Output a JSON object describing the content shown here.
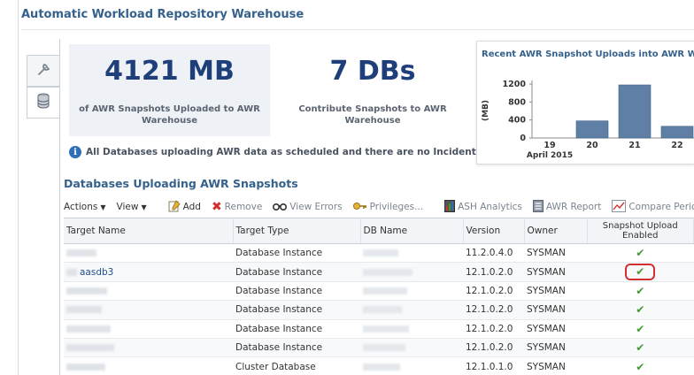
{
  "page": {
    "title": "Automatic Workload Repository Warehouse"
  },
  "side_tabs": [
    {
      "icon": "wrench-icon",
      "active": false
    },
    {
      "icon": "database-icon",
      "active": true
    }
  ],
  "summary": {
    "size_value": "4121 MB",
    "size_label": "of AWR Snapshots Uploaded to AWR Warehouse",
    "dbs_value": "7 DBs",
    "dbs_label": "Contribute Snapshots to AWR Warehouse"
  },
  "info": {
    "icon": "info-icon",
    "text": "All Databases uploading AWR data as scheduled and there are no Incidents."
  },
  "chart_data": {
    "type": "bar",
    "title": "Recent AWR Snapshot Uploads into AWR Wareh",
    "ylabel": "(MB)",
    "yticks": [
      "1200",
      "800",
      "400",
      "0"
    ],
    "ylim": [
      0,
      1200
    ],
    "categories": [
      "19",
      "20",
      "21",
      "22"
    ],
    "x_sublabel": "April 2015",
    "values": [
      0,
      380,
      1180,
      260
    ],
    "bar_color": "#5f7fa6"
  },
  "section": {
    "title": "Databases Uploading AWR Snapshots"
  },
  "toolbar": {
    "actions": "Actions",
    "view": "View",
    "add": "Add",
    "remove": "Remove",
    "view_errors": "View Errors",
    "privileges": "Privileges...",
    "ash_analytics": "ASH Analytics",
    "awr_report": "AWR Report",
    "compare_period": "Compare Period"
  },
  "table": {
    "headers": [
      "Target Name",
      "Target Type",
      "DB Name",
      "Version",
      "Owner",
      "Snapshot Upload Enabled"
    ],
    "rows": [
      {
        "target_name": "",
        "target_type": "Database Instance",
        "db_name": "",
        "version": "11.2.0.4.0",
        "owner": "SYSMAN",
        "enabled": "✔"
      },
      {
        "target_name": "aasdb3",
        "target_type": "Database Instance",
        "db_name": "",
        "version": "12.1.0.2.0",
        "owner": "SYSMAN",
        "enabled": "✔"
      },
      {
        "target_name": "",
        "target_type": "Database Instance",
        "db_name": "",
        "version": "12.1.0.2.0",
        "owner": "SYSMAN",
        "enabled": "✔"
      },
      {
        "target_name": "",
        "target_type": "Database Instance",
        "db_name": "",
        "version": "12.1.0.2.0",
        "owner": "SYSMAN",
        "enabled": "✔"
      },
      {
        "target_name": "",
        "target_type": "Database Instance",
        "db_name": "",
        "version": "12.1.0.2.0",
        "owner": "SYSMAN",
        "enabled": "✔"
      },
      {
        "target_name": "",
        "target_type": "Database Instance",
        "db_name": "",
        "version": "12.1.0.2.0",
        "owner": "SYSMAN",
        "enabled": "✔"
      },
      {
        "target_name": "",
        "target_type": "Cluster Database",
        "db_name": "",
        "version": "12.1.0.1.0",
        "owner": "SYSMAN",
        "enabled": "✔"
      }
    ]
  }
}
